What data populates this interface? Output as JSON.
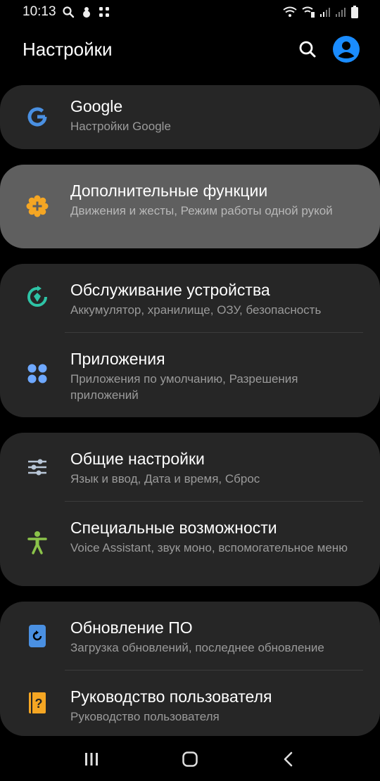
{
  "status_bar": {
    "time": "10:13",
    "left_icons": [
      "search-icon",
      "bug-icon",
      "grid-icon"
    ],
    "right_icons": [
      "wifi-icon",
      "wifi-call-icon",
      "signal-icon",
      "signal-icon",
      "battery-icon"
    ]
  },
  "header": {
    "title": "Настройки",
    "accent_color": "#1a8cff"
  },
  "cards": [
    {
      "items": [
        {
          "title": "Google",
          "subtitle": "Настройки Google",
          "icon": "google-icon",
          "icon_color": "#4a90e2"
        }
      ]
    },
    {
      "highlighted": true,
      "items": [
        {
          "title": "Дополнительные функции",
          "subtitle": "Движения и жесты, Режим работы одной рукой",
          "icon": "advanced-features-icon",
          "icon_color": "#f5a623"
        }
      ]
    },
    {
      "items": [
        {
          "title": "Обслуживание устройства",
          "subtitle": "Аккумулятор, хранилище, ОЗУ, безопасность",
          "icon": "device-care-icon",
          "icon_color": "#2ec4a6"
        },
        {
          "title": "Приложения",
          "subtitle": "Приложения по умолчанию, Разрешения приложений",
          "icon": "apps-icon",
          "icon_color": "#6ea8ff"
        }
      ]
    },
    {
      "items": [
        {
          "title": "Общие настройки",
          "subtitle": "Язык и ввод, Дата и время, Сброс",
          "icon": "sliders-icon",
          "icon_color": "#b9c7d8"
        },
        {
          "title": "Специальные возможности",
          "subtitle": "Voice Assistant, звук моно, вспомогательное меню",
          "icon": "accessibility-icon",
          "icon_color": "#8bc34a"
        }
      ]
    },
    {
      "items": [
        {
          "title": "Обновление ПО",
          "subtitle": "Загрузка обновлений, последнее обновление",
          "icon": "software-update-icon",
          "icon_color": "#4a90e2"
        },
        {
          "title": "Руководство пользователя",
          "subtitle": "Руководство пользователя",
          "icon": "user-manual-icon",
          "icon_color": "#f5a623"
        }
      ]
    }
  ],
  "nav_bar": {
    "buttons": [
      "recents-icon",
      "home-icon",
      "back-icon"
    ]
  }
}
